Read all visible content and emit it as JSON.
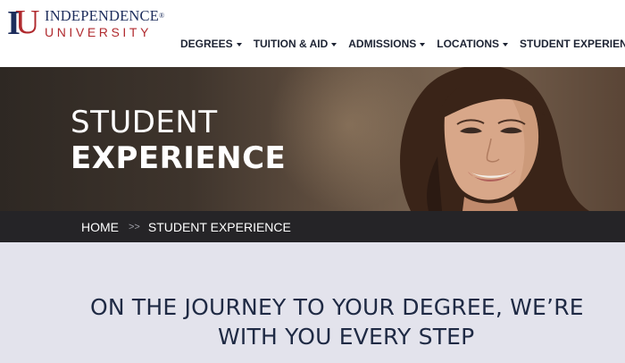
{
  "logo": {
    "mark_i": "I",
    "mark_u": "U",
    "line1": "INDEPENDENCE",
    "line1_mark": "®",
    "line2": "UNIVERSITY"
  },
  "nav": {
    "items": [
      {
        "label": "DEGREES"
      },
      {
        "label": "TUITION & AID"
      },
      {
        "label": "ADMISSIONS"
      },
      {
        "label": "LOCATIONS"
      },
      {
        "label": "STUDENT EXPERIENCE"
      }
    ]
  },
  "hero": {
    "title_line1": "STUDENT",
    "title_line2": "EXPERIENCE"
  },
  "breadcrumb": {
    "home": "HOME",
    "separator": ">>",
    "current": "STUDENT EXPERIENCE"
  },
  "main": {
    "heading_line1": "ON THE JOURNEY TO YOUR DEGREE, WE’RE",
    "heading_line2": "WITH YOU EVERY STEP"
  },
  "colors": {
    "navy": "#1d2d5c",
    "red": "#b02a2e",
    "breadcrumb_bg": "#252427",
    "page_bg": "#e3e3ec"
  }
}
